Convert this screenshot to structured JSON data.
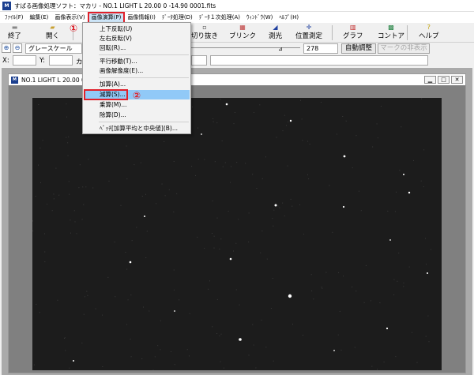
{
  "window": {
    "title": "すばる画像処理ソフト：マカリ - NO.1  LIGHT L 20.00 0    -14.90 0001.fits",
    "icon_text": "M"
  },
  "menubar": [
    {
      "label": "ﾌｧｲﾙ(F)"
    },
    {
      "label": "編集(E)"
    },
    {
      "label": "画像表示(V)"
    },
    {
      "label": "画像演算(P)"
    },
    {
      "label": "画像情報(I)"
    },
    {
      "label": "ﾃﾞｰﾀ処理(D)"
    },
    {
      "label": "ﾃﾞｰﾀ１次処理(A)"
    },
    {
      "label": "ｳｨﾝﾄﾞｳ(W)"
    },
    {
      "label": "ﾍﾙﾌﾟ(H)"
    }
  ],
  "toolbar": {
    "end": "終了",
    "open": "開く",
    "crop": "切り抜き",
    "blink": "ブリンク",
    "photometry": "測光",
    "position": "位置測定",
    "graph": "グラフ",
    "contour": "コントア",
    "help": "ヘルプ"
  },
  "controls": {
    "mode": "グレースケール",
    "level": "278",
    "auto_adjust": "自動調整",
    "hide_marks": "マークの非表示",
    "x_label": "X:",
    "y_label": "Y:",
    "ka_label": "カ"
  },
  "image_window": {
    "title": "NO.1  LIGHT L 20.00 0   -14.9"
  },
  "dropdown": [
    "上下反転(U)",
    "左右反転(V)",
    "回転(R)...",
    "平行移動(T)...",
    "画像解像度(E)...",
    "加算(A)...",
    "減算(S)...",
    "乗算(M)...",
    "除算(D)...",
    "ﾍﾞｯﾁ[加算平均と中央値](B)..."
  ],
  "callouts": {
    "one": "①",
    "two": "②"
  },
  "colors": {
    "highlight": "#e0202a",
    "menu_hover": "#91c9f7",
    "sky": "#1c1c1c"
  }
}
